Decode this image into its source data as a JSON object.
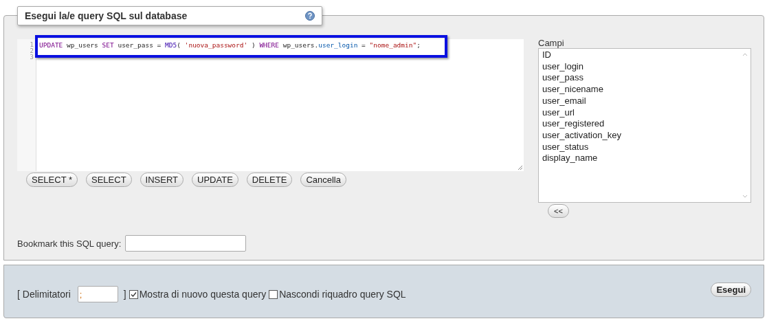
{
  "title": "Esegui la/e query SQL sul database",
  "editor": {
    "line_numbers": [
      "1",
      "2",
      "3"
    ],
    "highlighted": true,
    "tokens": [
      {
        "kind": "keyword",
        "text": "UPDATE"
      },
      {
        "kind": "plain",
        "text": " wp_users "
      },
      {
        "kind": "keyword",
        "text": "SET"
      },
      {
        "kind": "plain",
        "text": " user_pass = "
      },
      {
        "kind": "function",
        "text": "MD5"
      },
      {
        "kind": "plain",
        "text": "( "
      },
      {
        "kind": "string",
        "text": "'nuova_password'"
      },
      {
        "kind": "plain",
        "text": " ) "
      },
      {
        "kind": "keyword",
        "text": "WHERE"
      },
      {
        "kind": "plain",
        "text": " wp_users."
      },
      {
        "kind": "column",
        "text": "user_login"
      },
      {
        "kind": "plain",
        "text": " = "
      },
      {
        "kind": "string",
        "text": "\"nome_admin\""
      },
      {
        "kind": "plain",
        "text": ";"
      }
    ]
  },
  "buttons": [
    "SELECT *",
    "SELECT",
    "INSERT",
    "UPDATE",
    "DELETE",
    "Cancella"
  ],
  "fields": {
    "label": "Campi",
    "items": [
      "ID",
      "user_login",
      "user_pass",
      "user_nicename",
      "user_email",
      "user_url",
      "user_registered",
      "user_activation_key",
      "user_status",
      "display_name"
    ],
    "insert_button": "<<"
  },
  "bookmark": {
    "label": "Bookmark this SQL query:"
  },
  "footer": {
    "open_bracket": "[ Delimitatori",
    "delimiter": ";",
    "close_bracket": "]",
    "options": [
      {
        "label": "Mostra di nuovo questa query",
        "checked": true
      },
      {
        "label": "Nascondi riquadro query SQL",
        "checked": false
      }
    ],
    "submit": "Esegui"
  }
}
